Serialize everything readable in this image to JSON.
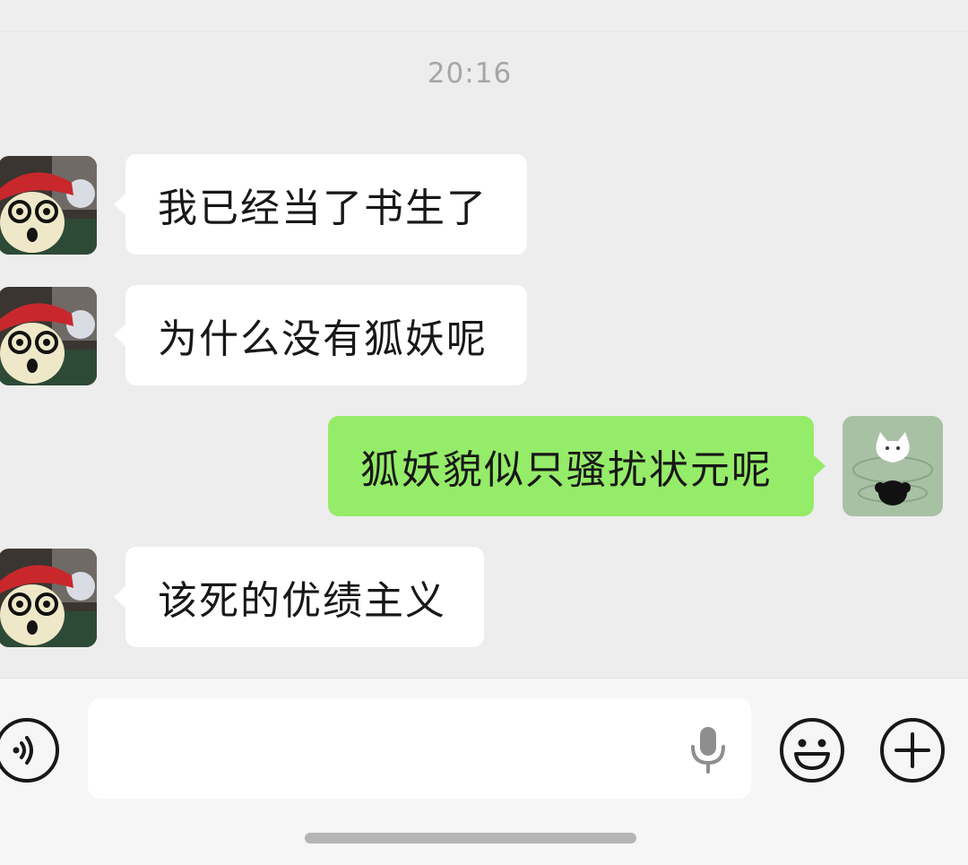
{
  "chat": {
    "timestamp": "20:16",
    "messages": [
      {
        "sender": "friend",
        "text": "我已经当了书生了"
      },
      {
        "sender": "friend",
        "text": "为什么没有狐妖呢"
      },
      {
        "sender": "me",
        "text": "狐妖貌似只骚扰状元呢"
      },
      {
        "sender": "friend",
        "text": "该死的优绩主义"
      }
    ]
  },
  "input_bar": {
    "message_value": "",
    "icons": [
      "voice-toggle-icon",
      "microphone-icon",
      "emoji-icon",
      "plus-icon"
    ]
  },
  "colors": {
    "background": "#ededed",
    "incoming_bubble": "#ffffff",
    "outgoing_bubble": "#95ec69",
    "timestamp_text": "#a6a6a6"
  }
}
